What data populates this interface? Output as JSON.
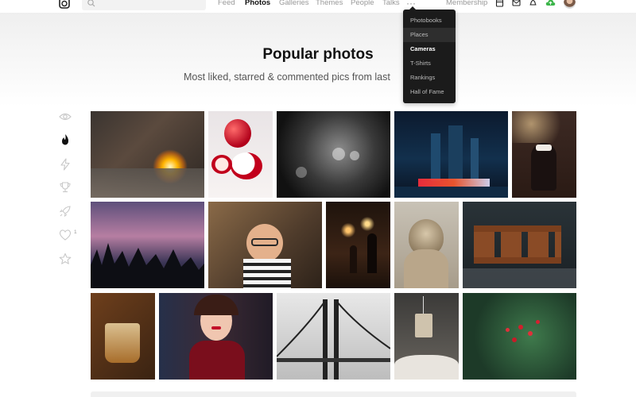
{
  "nav": {
    "items": [
      {
        "label": "Feed",
        "active": false
      },
      {
        "label": "Photos",
        "active": true
      },
      {
        "label": "Galleries",
        "active": false
      },
      {
        "label": "Themes",
        "active": false
      },
      {
        "label": "People",
        "active": false
      },
      {
        "label": "Talks",
        "active": false
      }
    ],
    "more_label": "···",
    "membership_label": "Membership",
    "icons": [
      "calendar-icon",
      "mail-icon",
      "bell-icon",
      "upload-cloud-icon"
    ]
  },
  "search": {
    "placeholder": ""
  },
  "dropdown": {
    "items": [
      {
        "label": "Photobooks",
        "state": "normal"
      },
      {
        "label": "Places",
        "state": "hover"
      },
      {
        "label": "Cameras",
        "state": "bold"
      },
      {
        "label": "T-Shirts",
        "state": "normal"
      },
      {
        "label": "Rankings",
        "state": "normal"
      },
      {
        "label": "Hall of Fame",
        "state": "normal"
      }
    ]
  },
  "hero": {
    "title": "Popular photos",
    "subtitle": "Most liked, starred & commented pics from last"
  },
  "sidebar": {
    "icons": [
      "eye-icon",
      "flame-icon",
      "lightning-icon",
      "trophy-icon",
      "rocket-icon",
      "heart-icon",
      "star-icon"
    ],
    "active": "flame-icon",
    "heart_count": "1"
  },
  "colors": {
    "accent_green": "#3cb54a",
    "dropdown_bg": "#1b1b1b"
  },
  "photos": [
    "fire-sparkler-street",
    "red-apple-slices",
    "bokeh-face-blackwhite",
    "toronto-city-night",
    "girl-bow-christmas-lights",
    "purple-sunset-trees",
    "boy-glasses",
    "night-street-people",
    "cat-looking-up",
    "rusty-chain-brick",
    "glass-of-whisky",
    "woman-red-lipstick",
    "bridge-blackwhite",
    "tea-bag-cup",
    "red-berries-green-leaves"
  ]
}
